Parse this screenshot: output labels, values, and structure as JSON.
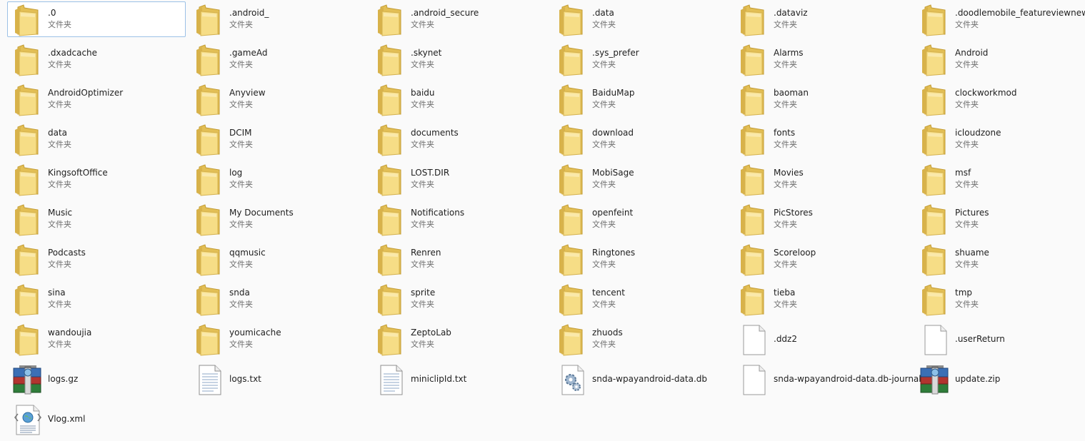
{
  "items": [
    {
      "name": ".0",
      "type": "文件夹",
      "icon": "folder"
    },
    {
      "name": ".android_",
      "type": "文件夹",
      "icon": "folder"
    },
    {
      "name": ".android_secure",
      "type": "文件夹",
      "icon": "folder"
    },
    {
      "name": ".data",
      "type": "文件夹",
      "icon": "folder"
    },
    {
      "name": ".dataviz",
      "type": "文件夹",
      "icon": "folder"
    },
    {
      "name": ".doodlemobile_featureviewnew",
      "type": "文件夹",
      "icon": "folder"
    },
    {
      "name": ".dxadcache",
      "type": "文件夹",
      "icon": "folder"
    },
    {
      "name": ".gameAd",
      "type": "文件夹",
      "icon": "folder"
    },
    {
      "name": ".skynet",
      "type": "文件夹",
      "icon": "folder"
    },
    {
      "name": ".sys_prefer",
      "type": "文件夹",
      "icon": "folder"
    },
    {
      "name": "Alarms",
      "type": "文件夹",
      "icon": "folder"
    },
    {
      "name": "Android",
      "type": "文件夹",
      "icon": "folder"
    },
    {
      "name": "AndroidOptimizer",
      "type": "文件夹",
      "icon": "folder"
    },
    {
      "name": "Anyview",
      "type": "文件夹",
      "icon": "folder"
    },
    {
      "name": "baidu",
      "type": "文件夹",
      "icon": "folder"
    },
    {
      "name": "BaiduMap",
      "type": "文件夹",
      "icon": "folder"
    },
    {
      "name": "baoman",
      "type": "文件夹",
      "icon": "folder"
    },
    {
      "name": "clockworkmod",
      "type": "文件夹",
      "icon": "folder"
    },
    {
      "name": "data",
      "type": "文件夹",
      "icon": "folder"
    },
    {
      "name": "DCIM",
      "type": "文件夹",
      "icon": "folder"
    },
    {
      "name": "documents",
      "type": "文件夹",
      "icon": "folder"
    },
    {
      "name": "download",
      "type": "文件夹",
      "icon": "folder"
    },
    {
      "name": "fonts",
      "type": "文件夹",
      "icon": "folder"
    },
    {
      "name": "icloudzone",
      "type": "文件夹",
      "icon": "folder"
    },
    {
      "name": "KingsoftOffice",
      "type": "文件夹",
      "icon": "folder"
    },
    {
      "name": "log",
      "type": "文件夹",
      "icon": "folder"
    },
    {
      "name": "LOST.DIR",
      "type": "文件夹",
      "icon": "folder"
    },
    {
      "name": "MobiSage",
      "type": "文件夹",
      "icon": "folder"
    },
    {
      "name": "Movies",
      "type": "文件夹",
      "icon": "folder"
    },
    {
      "name": "msf",
      "type": "文件夹",
      "icon": "folder"
    },
    {
      "name": "Music",
      "type": "文件夹",
      "icon": "folder"
    },
    {
      "name": "My Documents",
      "type": "文件夹",
      "icon": "folder"
    },
    {
      "name": "Notifications",
      "type": "文件夹",
      "icon": "folder"
    },
    {
      "name": "openfeint",
      "type": "文件夹",
      "icon": "folder"
    },
    {
      "name": "PicStores",
      "type": "文件夹",
      "icon": "folder"
    },
    {
      "name": "Pictures",
      "type": "文件夹",
      "icon": "folder"
    },
    {
      "name": "Podcasts",
      "type": "文件夹",
      "icon": "folder"
    },
    {
      "name": "qqmusic",
      "type": "文件夹",
      "icon": "folder"
    },
    {
      "name": "Renren",
      "type": "文件夹",
      "icon": "folder"
    },
    {
      "name": "Ringtones",
      "type": "文件夹",
      "icon": "folder"
    },
    {
      "name": "Scoreloop",
      "type": "文件夹",
      "icon": "folder"
    },
    {
      "name": "shuame",
      "type": "文件夹",
      "icon": "folder"
    },
    {
      "name": "sina",
      "type": "文件夹",
      "icon": "folder"
    },
    {
      "name": "snda",
      "type": "文件夹",
      "icon": "folder"
    },
    {
      "name": "sprite",
      "type": "文件夹",
      "icon": "folder"
    },
    {
      "name": "tencent",
      "type": "文件夹",
      "icon": "folder"
    },
    {
      "name": "tieba",
      "type": "文件夹",
      "icon": "folder"
    },
    {
      "name": "tmp",
      "type": "文件夹",
      "icon": "folder"
    },
    {
      "name": "wandoujia",
      "type": "文件夹",
      "icon": "folder"
    },
    {
      "name": "youmicache",
      "type": "文件夹",
      "icon": "folder"
    },
    {
      "name": "ZeptoLab",
      "type": "文件夹",
      "icon": "folder"
    },
    {
      "name": "zhuods",
      "type": "文件夹",
      "icon": "folder"
    },
    {
      "name": ".ddz2",
      "type": "",
      "icon": "blank-file"
    },
    {
      "name": ".userReturn",
      "type": "",
      "icon": "blank-file"
    },
    {
      "name": "logs.gz",
      "type": "",
      "icon": "archive"
    },
    {
      "name": "logs.txt",
      "type": "",
      "icon": "text-file"
    },
    {
      "name": "miniclipId.txt",
      "type": "",
      "icon": "text-file"
    },
    {
      "name": "snda-wpayandroid-data.db",
      "type": "",
      "icon": "settings-file"
    },
    {
      "name": "snda-wpayandroid-data.db-journal",
      "type": "",
      "icon": "blank-file"
    },
    {
      "name": "update.zip",
      "type": "",
      "icon": "archive"
    },
    {
      "name": "Vlog.xml",
      "type": "",
      "icon": "xml-file"
    }
  ],
  "selected_index": 0,
  "colors": {
    "folder_back": "#e3bf55",
    "folder_front": "#f6dd86",
    "selection_border": "#9cc1e6",
    "secondary_text": "#6d6d6d"
  }
}
